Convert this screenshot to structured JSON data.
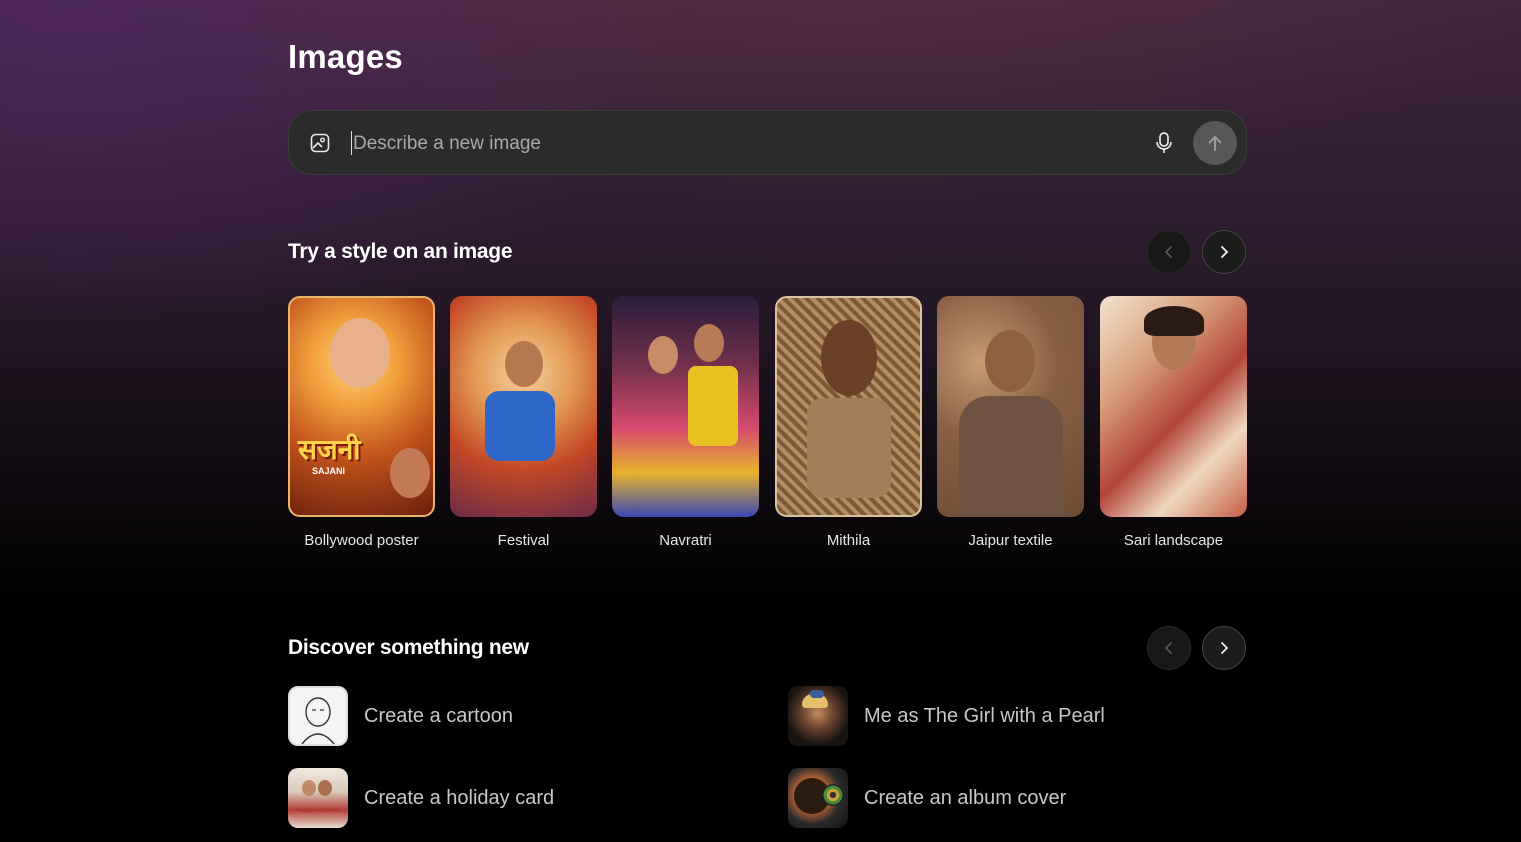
{
  "page": {
    "title": "Images"
  },
  "prompt": {
    "placeholder": "Describe a new image",
    "upload_icon": "image-upload-icon",
    "mic_icon": "microphone-icon",
    "send_icon": "arrow-up-icon"
  },
  "styles": {
    "title": "Try a style on an image",
    "items": [
      {
        "label": "Bollywood poster",
        "poster_text": "सजनी",
        "poster_subtext": "SAJANI"
      },
      {
        "label": "Festival"
      },
      {
        "label": "Navratri"
      },
      {
        "label": "Mithila"
      },
      {
        "label": "Jaipur textile"
      },
      {
        "label": "Sari landscape"
      }
    ]
  },
  "discover": {
    "title": "Discover something new",
    "items": [
      {
        "label": "Create a cartoon"
      },
      {
        "label": "Me as The Girl with a Pearl"
      },
      {
        "label": "Create a holiday card",
        "card_text": "Happy Holidays!"
      },
      {
        "label": "Create an album cover"
      }
    ]
  },
  "colors": {
    "background_top": "#3f2540",
    "background_bottom": "#000000",
    "prompt_bg": "#2b2b2b",
    "send_button": "#575757"
  }
}
